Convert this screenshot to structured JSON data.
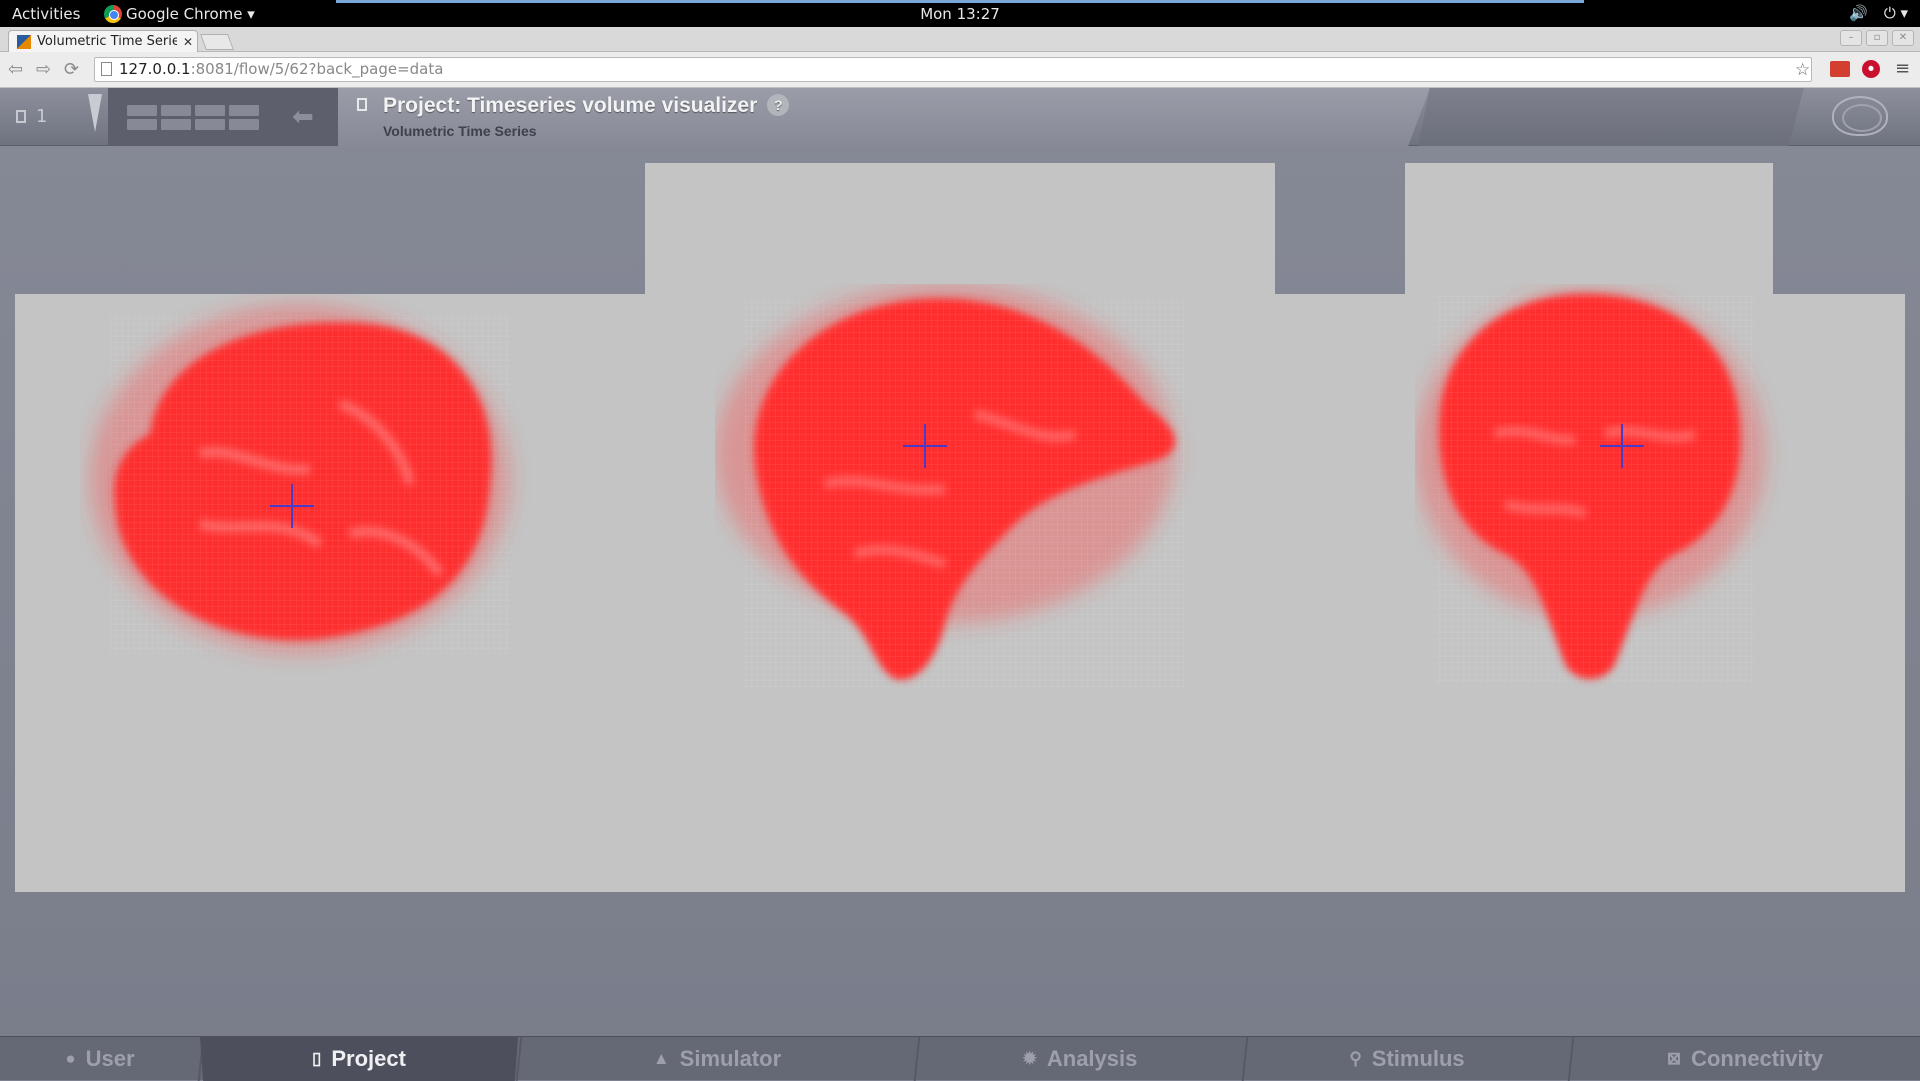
{
  "gnome": {
    "activities": "Activities",
    "app_name": "Google Chrome ▾",
    "clock": "Mon 13:27",
    "volume_icon": "🔊",
    "power_icon": "⏻ ▾"
  },
  "browser": {
    "tab_title": "Volumetric Time Series",
    "tab_close": "✕",
    "url_host": "127.0.0.1",
    "url_path": ":8081/flow/5/62?back_page=data",
    "back_icon": "⇦",
    "forward_icon": "⇨",
    "reload_icon": "⟳",
    "star_icon": "☆",
    "ext_badge": "⏺",
    "menu_icon": "≡",
    "win_min": "–",
    "win_max": "▫",
    "win_close": "✕"
  },
  "header": {
    "project_count": "1",
    "back_arrow": "⬅",
    "title": "Project: Timeseries volume visualizer",
    "help": "?",
    "subtitle": "Volumetric Time Series"
  },
  "nav": {
    "items": [
      {
        "label": "User",
        "icon": "●"
      },
      {
        "label": "Project",
        "icon": "▯"
      },
      {
        "label": "Simulator",
        "icon": "▲"
      },
      {
        "label": "Analysis",
        "icon": "✹"
      },
      {
        "label": "Stimulus",
        "icon": "⚲"
      },
      {
        "label": "Connectivity",
        "icon": "⊠"
      }
    ],
    "active": "Project"
  },
  "colors": {
    "brain_red": "#ff2020",
    "crosshair": "#4a3ac8",
    "canvas_bg": "#c4c4c4"
  }
}
